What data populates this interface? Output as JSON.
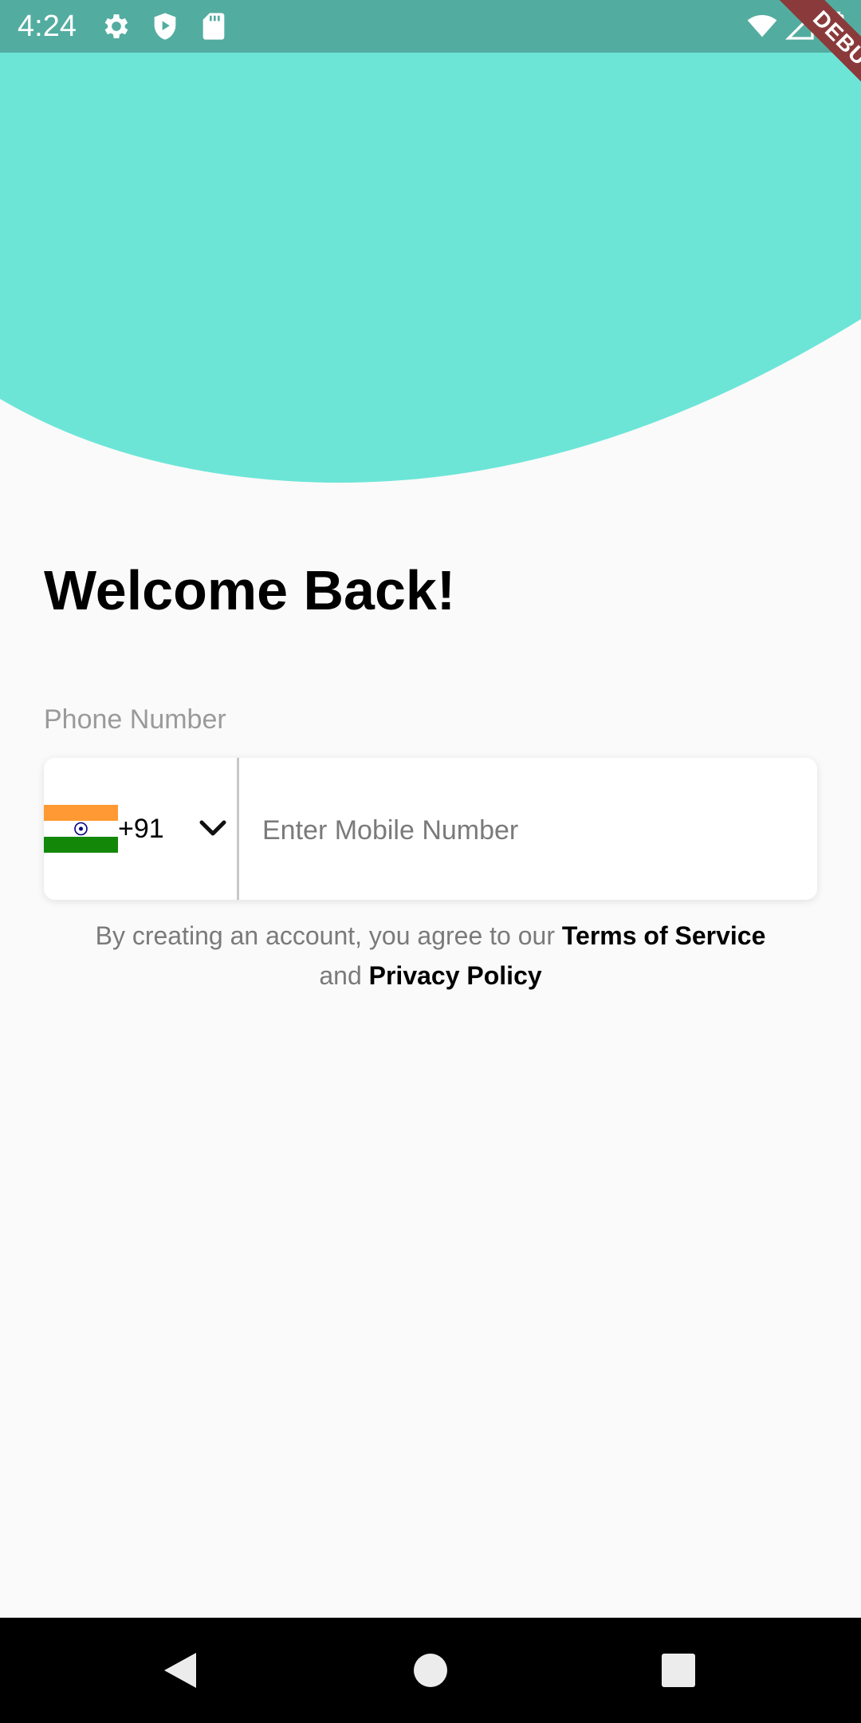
{
  "status_bar": {
    "time": "4:24",
    "left_icons": [
      "gear-icon",
      "shield-play-icon",
      "sd-card-icon"
    ],
    "right_icons": [
      "wifi-icon",
      "signal-icon",
      "battery-icon"
    ]
  },
  "debug_banner": {
    "label": "DEBUG"
  },
  "colors": {
    "accent": "#6ce5d7",
    "status_bar": "#53aca0",
    "background": "#fafafa",
    "debug_banner": "#8a3a3a"
  },
  "login": {
    "title": "Welcome Back!",
    "phone_label": "Phone Number",
    "country": {
      "flag_icon": "india-flag-icon",
      "dial_code": "+91"
    },
    "mobile_placeholder": "Enter Mobile Number",
    "mobile_value": ""
  },
  "terms": {
    "prefix": "By creating an account, you agree to our",
    "tos_link": "Terms of Service",
    "conjunction": "and",
    "privacy_link": "Privacy Policy"
  },
  "nav": {
    "buttons": [
      "back-icon",
      "home-icon",
      "recents-icon"
    ]
  }
}
